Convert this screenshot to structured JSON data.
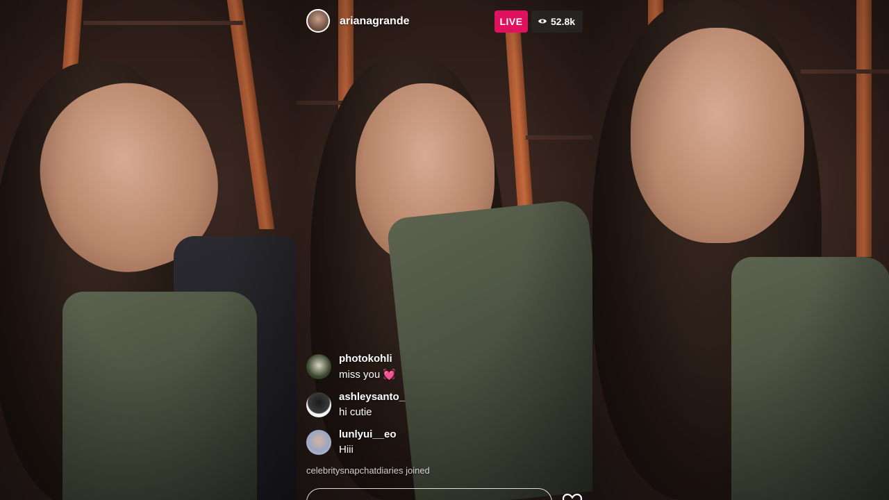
{
  "broadcast": {
    "username": "arianagrande",
    "live_label": "LIVE",
    "viewer_count": "52.8k"
  },
  "comments": [
    {
      "user": "photokohli",
      "text": "miss you",
      "emoji": "💓"
    },
    {
      "user": "ashleysanto_",
      "text": "hi cutie",
      "emoji": ""
    },
    {
      "user": "lunlyui__eo",
      "text": "Hiii",
      "emoji": ""
    }
  ],
  "joined_notice": "celebritysnapchatdiaries joined",
  "icons": {
    "eye": "eye-icon",
    "heart": "heart-icon"
  },
  "colors": {
    "live_badge": "#e0115f",
    "viewer_badge_bg": "#282828"
  }
}
